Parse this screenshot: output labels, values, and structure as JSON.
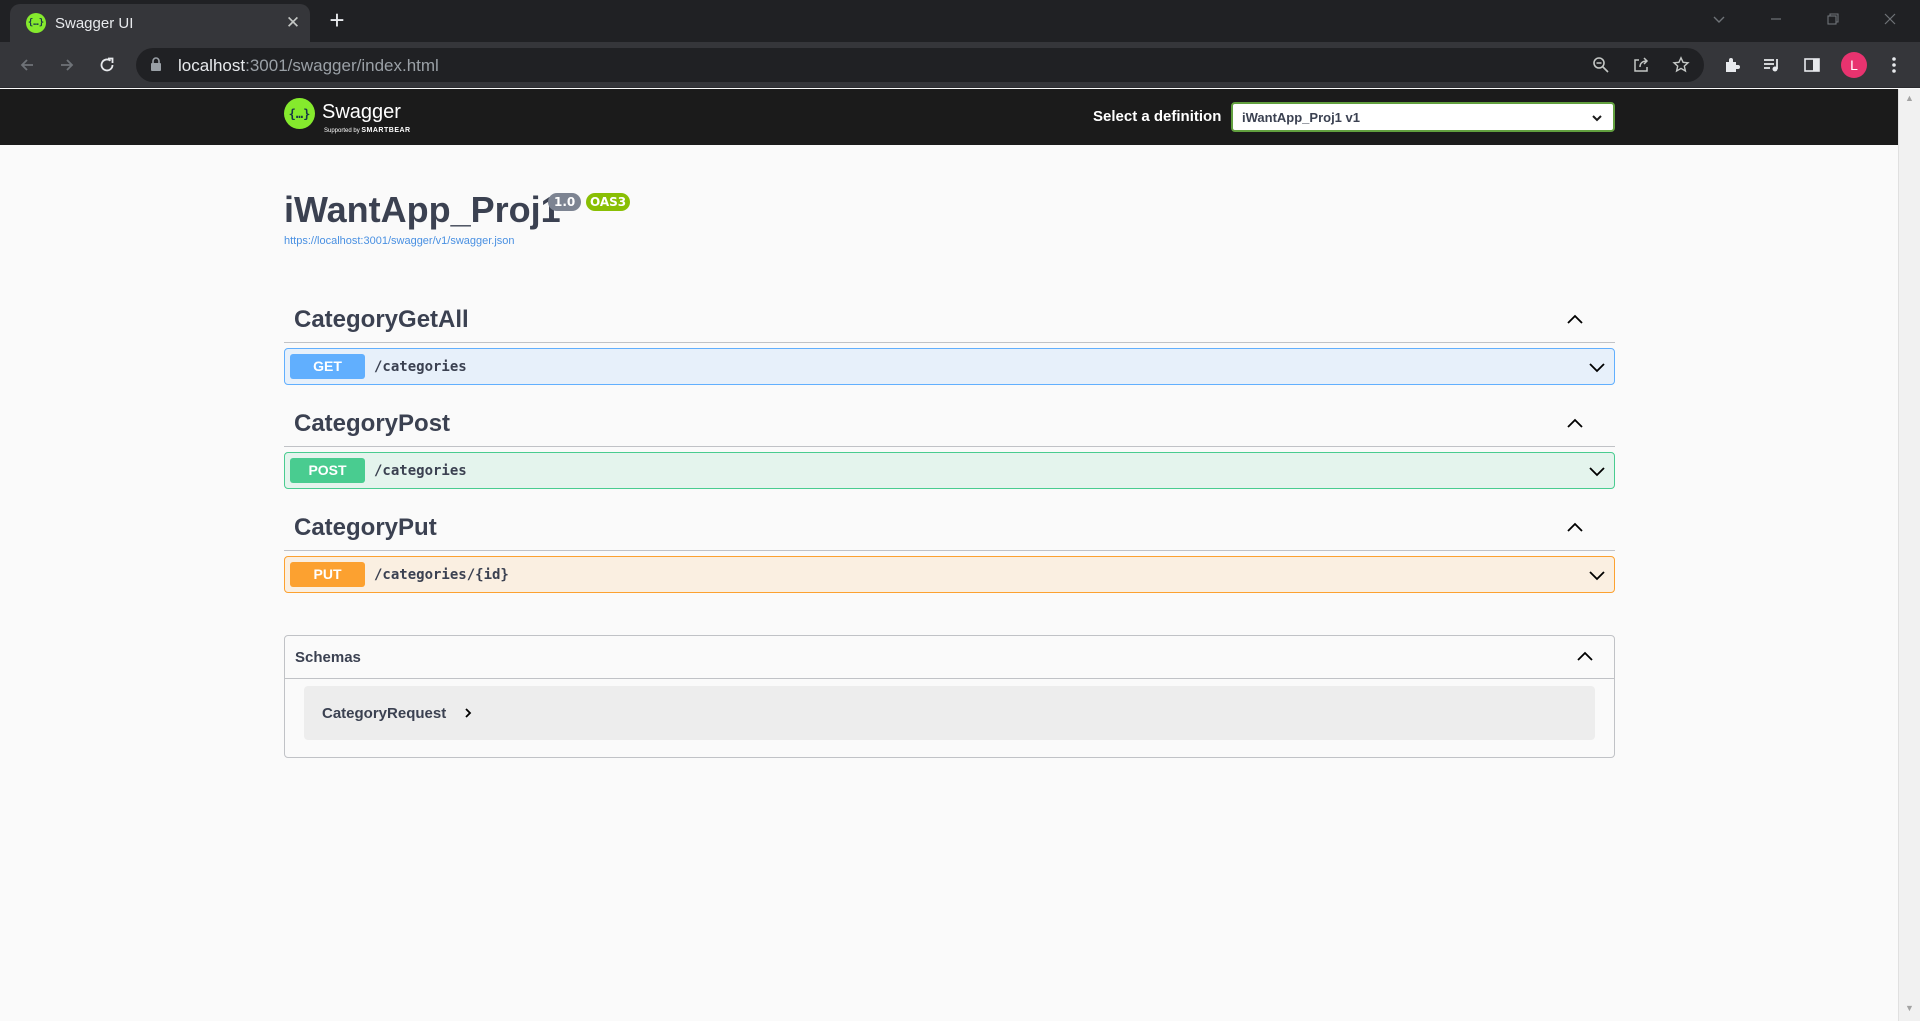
{
  "browser": {
    "tab_title": "Swagger UI",
    "url_host": "localhost",
    "url_rest": ":3001/swagger/index.html",
    "profile_initial": "L"
  },
  "topbar": {
    "logo_text": "Swagger",
    "logo_sub_prefix": "Supported by",
    "logo_sub_brand": "SMARTBEAR",
    "definition_label": "Select a definition",
    "definition_value": "iWantApp_Proj1 v1"
  },
  "info": {
    "title": "iWantApp_Proj1",
    "version": "1.0",
    "oas": "OAS3",
    "spec_url": "https://localhost:3001/swagger/v1/swagger.json"
  },
  "tags": [
    {
      "name": "CategoryGetAll",
      "method": "GET",
      "path": "/categories"
    },
    {
      "name": "CategoryPost",
      "method": "POST",
      "path": "/categories"
    },
    {
      "name": "CategoryPut",
      "method": "PUT",
      "path": "/categories/{id}"
    }
  ],
  "schemas": {
    "title": "Schemas",
    "models": [
      "CategoryRequest"
    ]
  },
  "colors": {
    "get": "#61affe",
    "post": "#49cc90",
    "put": "#fca130",
    "swagger_green": "#85ea2d",
    "oas_badge": "#89bf04"
  }
}
